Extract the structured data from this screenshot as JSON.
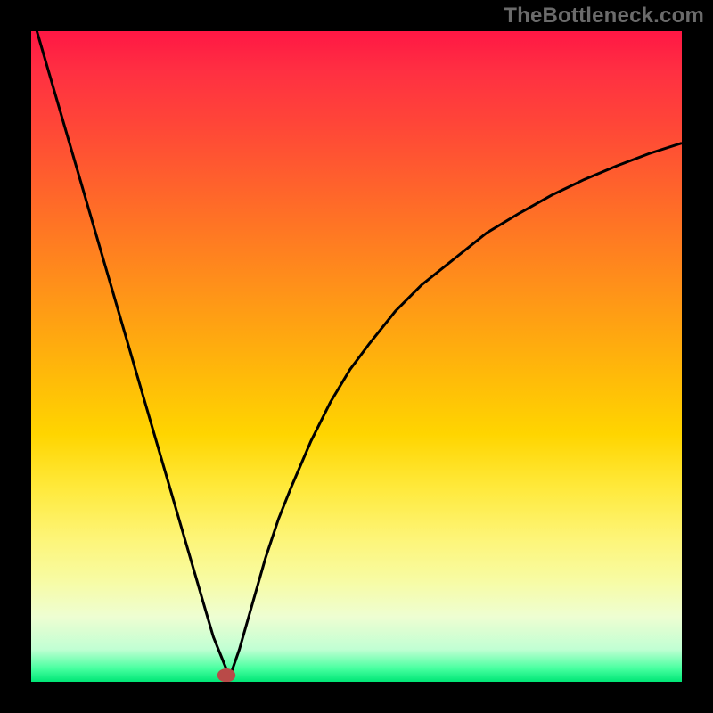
{
  "watermark": "TheBottleneck.com",
  "chart_data": {
    "type": "line",
    "title": "",
    "xlabel": "",
    "ylabel": "",
    "xlim": [
      0,
      1
    ],
    "ylim": [
      0,
      1
    ],
    "colors": {
      "top": "#ff1744",
      "mid": "#ffd500",
      "bottom": "#00e676",
      "curve": "#000000",
      "marker": "#b94a48"
    },
    "marker": {
      "x": 0.3,
      "y": 0.01,
      "r": 0.014
    },
    "series": [
      {
        "name": "left",
        "x": [
          0.0,
          0.03,
          0.06,
          0.09,
          0.12,
          0.15,
          0.18,
          0.21,
          0.24,
          0.27,
          0.28,
          0.305
        ],
        "values": [
          1.03,
          0.927,
          0.824,
          0.721,
          0.618,
          0.515,
          0.412,
          0.309,
          0.206,
          0.103,
          0.069,
          0.007
        ]
      },
      {
        "name": "right",
        "x": [
          0.305,
          0.32,
          0.34,
          0.36,
          0.38,
          0.4,
          0.43,
          0.46,
          0.49,
          0.52,
          0.56,
          0.6,
          0.65,
          0.7,
          0.75,
          0.8,
          0.85,
          0.9,
          0.95,
          1.0
        ],
        "values": [
          0.007,
          0.05,
          0.12,
          0.19,
          0.25,
          0.3,
          0.37,
          0.43,
          0.48,
          0.52,
          0.57,
          0.61,
          0.65,
          0.69,
          0.72,
          0.748,
          0.772,
          0.793,
          0.812,
          0.828
        ]
      }
    ]
  }
}
